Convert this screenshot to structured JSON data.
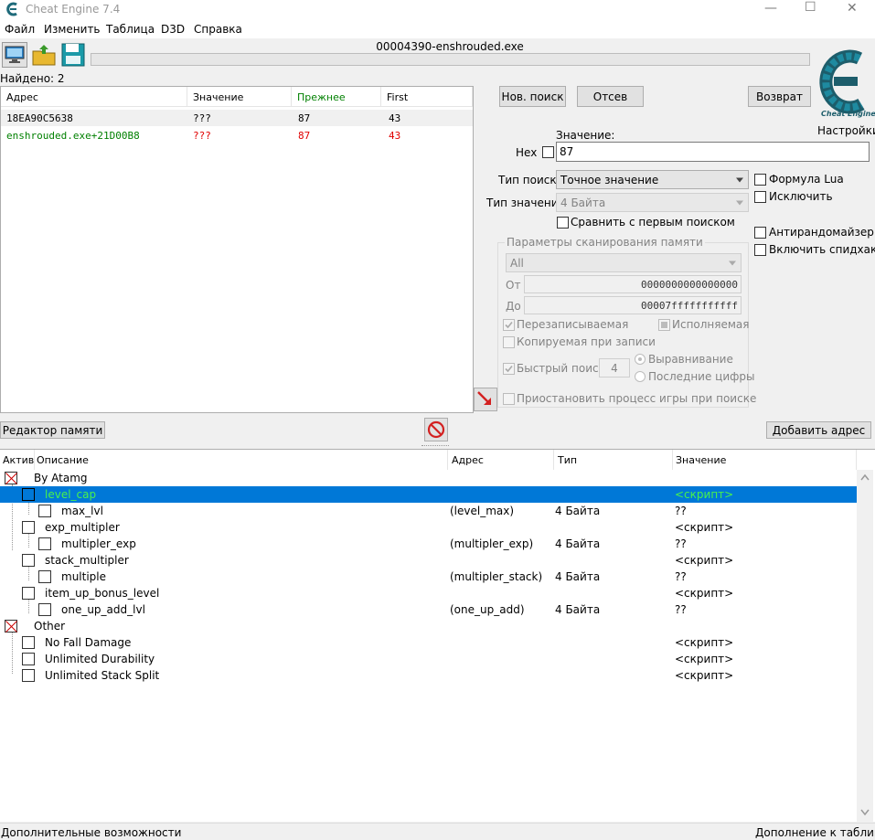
{
  "window": {
    "title": "Cheat Engine 7.4",
    "min": "—",
    "max": "☐",
    "close": "✕"
  },
  "menu": [
    "Файл",
    "Изменить",
    "Таблица",
    "D3D",
    "Справка"
  ],
  "process_name": "00004390-enshrouded.exe",
  "found_label": "Найдено: 2",
  "settings_label": "Настройки",
  "logo_text": "Cheat Engine",
  "results": {
    "headers": [
      "Адрес",
      "Значение",
      "Прежнее",
      "First"
    ],
    "rows": [
      {
        "address": "18EA90C5638",
        "value": "???",
        "previous": "87",
        "first": "43"
      },
      {
        "address": "enshrouded.exe+21D00B8",
        "value": "???",
        "previous": "87",
        "first": "43"
      }
    ]
  },
  "scan": {
    "new_scan": "Нов. поиск",
    "next_scan": "Отсев",
    "undo": "Возврат",
    "value_label": "Значение:",
    "hex_label": "Hex",
    "value": "87",
    "scan_type_label": "Тип поиска",
    "scan_type": "Точное значение",
    "value_type_label": "Тип значения",
    "value_type": "4 Байта",
    "compare_first": "Сравнить с первым поиском",
    "lua_formula": "Формула Lua",
    "exclude": "Исключить",
    "anti_random": "Антирандомайзер",
    "speedhack": "Включить спидхак",
    "mem_group": "Параметры сканирования памяти",
    "region": "All",
    "from_label": "От",
    "from": "0000000000000000",
    "to_label": "До",
    "to": "00007fffffffffff",
    "writable": "Перезаписываемая",
    "executable": "Исполняемая",
    "copy_on_write": "Копируемая при записи",
    "fast_scan": "Быстрый поиск",
    "fast_value": "4",
    "alignment": "Выравнивание",
    "last_digits": "Последние цифры",
    "pause": "Приостановить процесс игры при поиске"
  },
  "buttons": {
    "memory_view": "Редактор памяти",
    "add_address": "Добавить адрес"
  },
  "table": {
    "headers": [
      "Актив",
      "Описание",
      "Адрес",
      "Тип",
      "Значение"
    ],
    "rows": [
      {
        "desc": "By Atamg",
        "addr": "",
        "type": "",
        "val": ""
      },
      {
        "desc": "level_cap",
        "addr": "",
        "type": "",
        "val": "<скрипт>"
      },
      {
        "desc": "max_lvl",
        "addr": "(level_max)",
        "type": "4 Байта",
        "val": "??"
      },
      {
        "desc": "exp_multipler",
        "addr": "",
        "type": "",
        "val": "<скрипт>"
      },
      {
        "desc": "multipler_exp",
        "addr": "(multipler_exp)",
        "type": "4 Байта",
        "val": "??"
      },
      {
        "desc": "stack_multipler",
        "addr": "",
        "type": "",
        "val": "<скрипт>"
      },
      {
        "desc": "multiple",
        "addr": "(multipler_stack)",
        "type": "4 Байта",
        "val": "??"
      },
      {
        "desc": "item_up_bonus_level",
        "addr": "",
        "type": "",
        "val": "<скрипт>"
      },
      {
        "desc": "one_up_add_lvl",
        "addr": "(one_up_add)",
        "type": "4 Байта",
        "val": "??"
      },
      {
        "desc": "Other",
        "addr": "",
        "type": "",
        "val": ""
      },
      {
        "desc": "No Fall Damage",
        "addr": "",
        "type": "",
        "val": "<скрипт>"
      },
      {
        "desc": "Unlimited Durability",
        "addr": "",
        "type": "",
        "val": "<скрипт>"
      },
      {
        "desc": "Unlimited Stack Split",
        "addr": "",
        "type": "",
        "val": "<скрипт>"
      }
    ]
  },
  "status": {
    "left": "Дополнительные возможности",
    "right": "Дополнение к таблице"
  },
  "colors": {
    "green": "#008000",
    "red": "#e00000",
    "selection": "#0078d7"
  }
}
